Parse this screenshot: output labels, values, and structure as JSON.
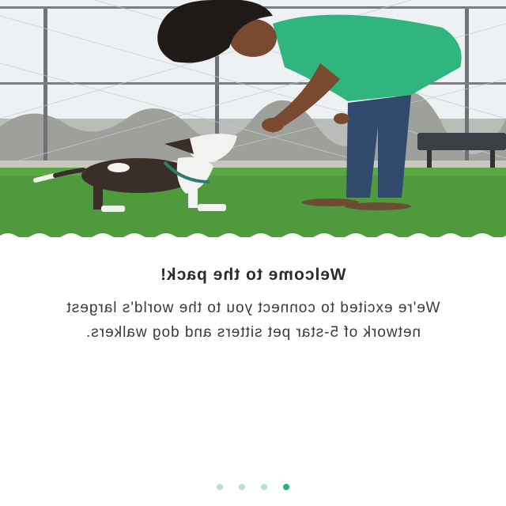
{
  "onboarding": {
    "title": "Welcome to the pack!",
    "subtitle": "We're excited to connect you to the world's largest network of 5-star pet sitters and dog walkers.",
    "hero_image": {
      "alt": "photo-person-playing-with-dog"
    },
    "pagination": {
      "total": 4,
      "active_index": 3
    }
  },
  "colors": {
    "accent": "#27b27b",
    "dot_inactive": "#b7e2d0",
    "text": "#2b2b2b",
    "shirt_green": "#2fb57d",
    "grass": "#4e9a3c"
  }
}
